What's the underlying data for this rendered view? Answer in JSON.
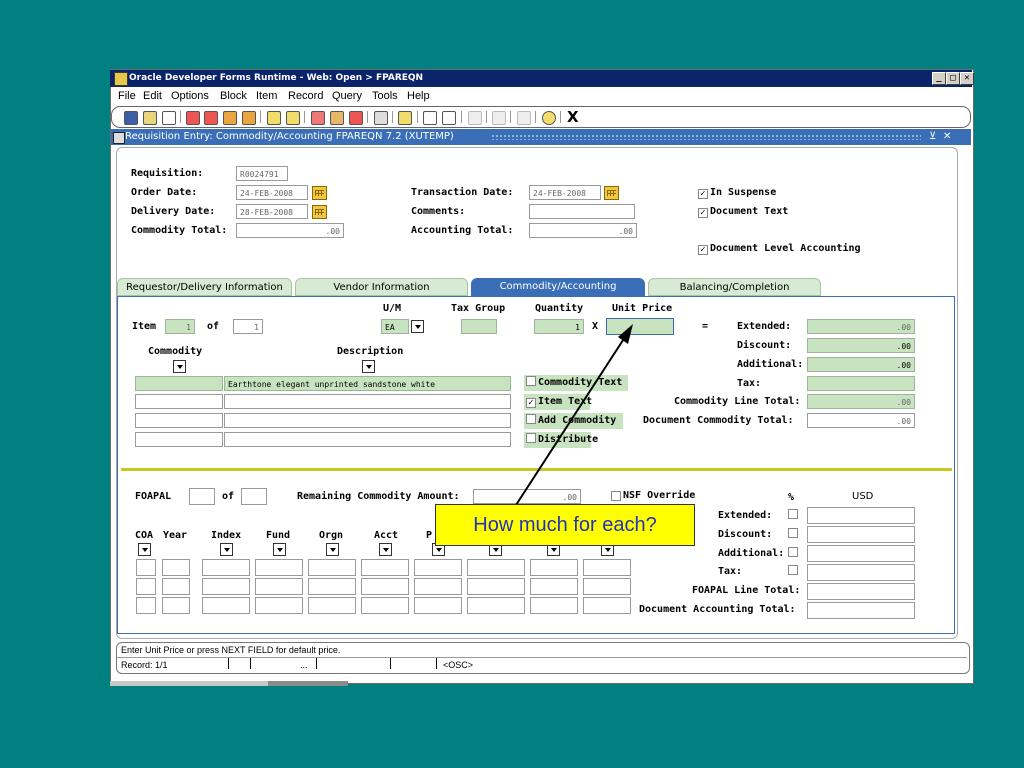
{
  "window": {
    "title": "Oracle Developer Forms Runtime - Web: Open > FPAREQN"
  },
  "menu": [
    "File",
    "Edit",
    "Options",
    "Block",
    "Item",
    "Record",
    "Query",
    "Tools",
    "Help"
  ],
  "form": {
    "title": "Requisition Entry: Commodity/Accounting  FPAREQN  7.2  (XUTEMP)"
  },
  "header": {
    "requisition_label": "Requisition:",
    "requisition": "R0024791",
    "order_date_label": "Order Date:",
    "order_date": "24-FEB-2008",
    "delivery_date_label": "Delivery Date:",
    "delivery_date": "28-FEB-2008",
    "commodity_total_label": "Commodity Total:",
    "commodity_total": ".00",
    "transaction_date_label": "Transaction Date:",
    "transaction_date": "24-FEB-2008",
    "comments_label": "Comments:",
    "accounting_total_label": "Accounting Total:",
    "accounting_total": ".00",
    "in_suspense": "In Suspense",
    "document_text": "Document Text",
    "doc_level_accounting": "Document Level Accounting"
  },
  "tabs": [
    "Requestor/Delivery Information",
    "Vendor Information",
    "Commodity/Accounting",
    "Balancing/Completion"
  ],
  "commodity": {
    "item_label": "Item",
    "item": "1",
    "of_label": "of",
    "of": "1",
    "um_label": "U/M",
    "um": "EA",
    "tax_group_label": "Tax Group",
    "quantity_label": "Quantity",
    "quantity": "1",
    "x_label": "X",
    "unit_price_label": "Unit Price",
    "eq_label": "=",
    "commodity_label": "Commodity",
    "description_label": "Description",
    "description": "Earthtone elegant unprinted sandstone white",
    "commodity_text": "Commodity Text",
    "item_text": "Item Text",
    "add_commodity": "Add Commodity",
    "distribute": "Distribute",
    "extended_label": "Extended:",
    "extended": ".00",
    "discount_label": "Discount:",
    "discount": ".00",
    "additional_label": "Additional:",
    "additional": ".00",
    "tax_label": "Tax:",
    "line_total_label": "Commodity Line Total:",
    "line_total": ".00",
    "doc_total_label": "Document Commodity Total:",
    "doc_total": ".00"
  },
  "foapal": {
    "foapal_label": "FOAPAL",
    "of_label": "of",
    "remaining_label": "Remaining Commodity Amount:",
    "remaining": ".00",
    "nsf_override": "NSF Override",
    "pct_label": "%",
    "usd_label": "USD",
    "coa_label": "COA",
    "year_label": "Year",
    "index_label": "Index",
    "fund_label": "Fund",
    "orgn_label": "Orgn",
    "acct_label": "Acct",
    "p_label": "P",
    "extended_label": "Extended:",
    "discount_label": "Discount:",
    "additional_label": "Additional:",
    "tax_label": "Tax:",
    "line_total_label": "FOAPAL Line Total:",
    "doc_total_label": "Document  Accounting  Total:"
  },
  "callout": {
    "text": "How much for each?"
  },
  "status": {
    "message": "Enter Unit Price or press NEXT FIELD for default price.",
    "record": "Record: 1/1",
    "dots": "...",
    "osc": "<OSC>"
  },
  "colors": {
    "background": "#008080",
    "titlebar": "#0a246a",
    "form_titlebar": "#3a6fb7",
    "field_green": "#c8e3c0",
    "divider": "#c8c81e"
  }
}
